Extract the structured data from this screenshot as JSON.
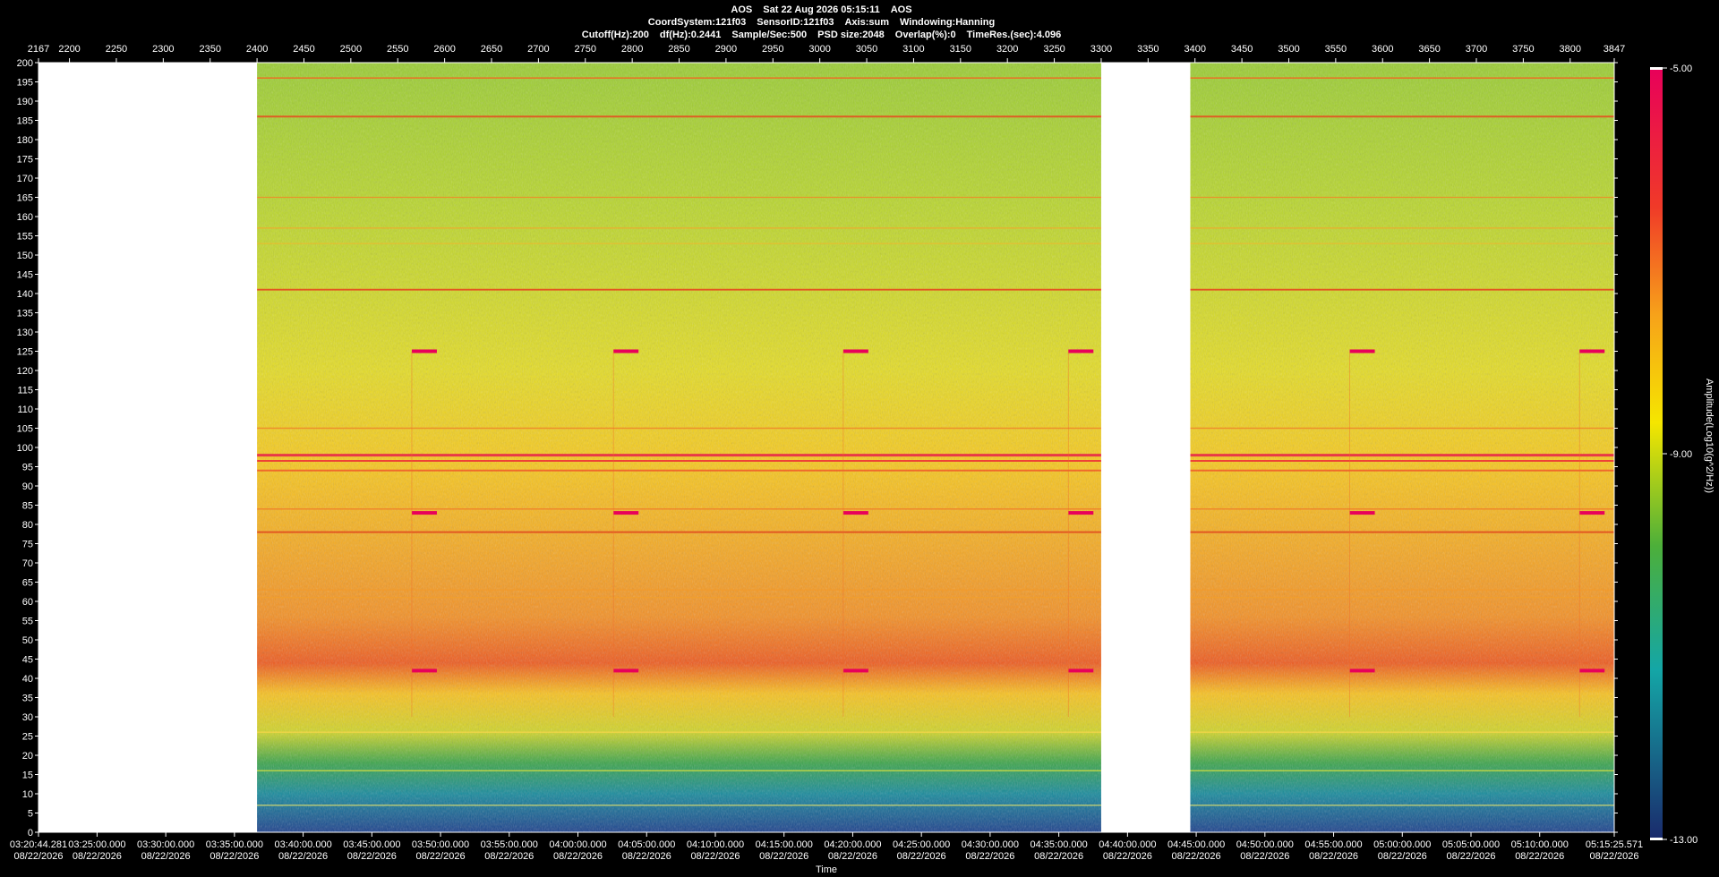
{
  "header": {
    "line1": [
      "AOS",
      "Sat 22 Aug 2026 05:15:11",
      "AOS"
    ],
    "line2": [
      "CoordSystem:121f03",
      "SensorID:121f03",
      "Axis:sum",
      "Windowing:Hanning"
    ],
    "line3": [
      "Cutoff(Hz):200",
      "df(Hz):0.2441",
      "Sample/Sec:500",
      "PSD size:2048",
      "Overlap(%):0",
      "TimeRes.(sec):4.096"
    ]
  },
  "chart_data": {
    "type": "heatmap",
    "title": "AOS  Sat 22 Aug 2026 05:15:11  AOS",
    "xlabel": "Time",
    "ylabel": "",
    "colorbar_label": "Amplitude(Log10(g^2/Hz))",
    "colorbar_ticks": [
      "-5.00",
      "-9.00",
      "-13.00"
    ],
    "color_range": [
      -13,
      -5
    ],
    "ylim": [
      0,
      200
    ],
    "y_ticks": [
      0,
      5,
      10,
      15,
      20,
      25,
      30,
      35,
      40,
      45,
      50,
      55,
      60,
      65,
      70,
      75,
      80,
      85,
      90,
      95,
      100,
      105,
      110,
      115,
      120,
      125,
      130,
      135,
      140,
      145,
      150,
      155,
      160,
      165,
      170,
      175,
      180,
      185,
      190,
      195,
      200
    ],
    "top_axis_range": [
      2167,
      3847
    ],
    "top_ticks": [
      "2167",
      "2200",
      "2250",
      "2300",
      "2350",
      "2400",
      "2450",
      "2500",
      "2550",
      "2600",
      "2650",
      "2700",
      "2750",
      "2800",
      "2850",
      "2900",
      "2950",
      "3000",
      "3050",
      "3100",
      "3150",
      "3200",
      "3250",
      "3300",
      "3350",
      "3400",
      "3450",
      "3500",
      "3550",
      "3600",
      "3650",
      "3700",
      "3750",
      "3800",
      "3847"
    ],
    "time_ticks": [
      {
        "time": "03:20:44.281",
        "date": "08/22/2026"
      },
      {
        "time": "03:25:00.000",
        "date": "08/22/2026"
      },
      {
        "time": "03:30:00.000",
        "date": "08/22/2026"
      },
      {
        "time": "03:35:00.000",
        "date": "08/22/2026"
      },
      {
        "time": "03:40:00.000",
        "date": "08/22/2026"
      },
      {
        "time": "03:45:00.000",
        "date": "08/22/2026"
      },
      {
        "time": "03:50:00.000",
        "date": "08/22/2026"
      },
      {
        "time": "03:55:00.000",
        "date": "08/22/2026"
      },
      {
        "time": "04:00:00.000",
        "date": "08/22/2026"
      },
      {
        "time": "04:05:00.000",
        "date": "08/22/2026"
      },
      {
        "time": "04:10:00.000",
        "date": "08/22/2026"
      },
      {
        "time": "04:15:00.000",
        "date": "08/22/2026"
      },
      {
        "time": "04:20:00.000",
        "date": "08/22/2026"
      },
      {
        "time": "04:25:00.000",
        "date": "08/22/2026"
      },
      {
        "time": "04:30:00.000",
        "date": "08/22/2026"
      },
      {
        "time": "04:35:00.000",
        "date": "08/22/2026"
      },
      {
        "time": "04:40:00.000",
        "date": "08/22/2026"
      },
      {
        "time": "04:45:00.000",
        "date": "08/22/2026"
      },
      {
        "time": "04:50:00.000",
        "date": "08/22/2026"
      },
      {
        "time": "04:55:00.000",
        "date": "08/22/2026"
      },
      {
        "time": "05:00:00.000",
        "date": "08/22/2026"
      },
      {
        "time": "05:05:00.000",
        "date": "08/22/2026"
      },
      {
        "time": "05:10:00.000",
        "date": "08/22/2026"
      },
      {
        "time": "05:15:25.571",
        "date": "08/22/2026"
      }
    ],
    "data_gaps_top_axis": [
      [
        2167,
        2400
      ],
      [
        3300,
        3395
      ]
    ],
    "colors": {
      "high": "#e8005a",
      "mid": "#f5e600",
      "low": "#1a2a6c"
    }
  }
}
